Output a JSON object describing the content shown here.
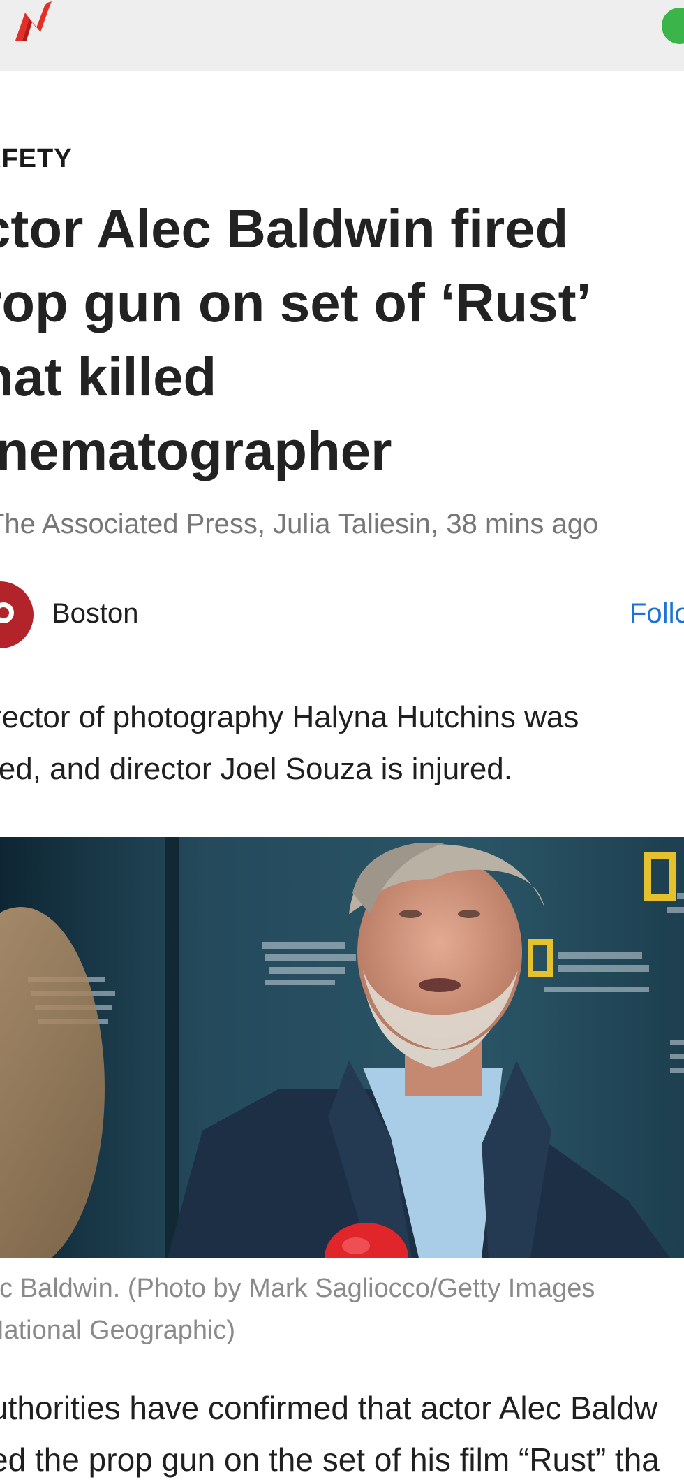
{
  "app": {
    "logo_icon": "msn-logo-icon",
    "profile_icon": "profile-avatar-icon",
    "accent_color": "#e23028",
    "profile_color": "#3bb54a"
  },
  "article": {
    "category": "AFETY",
    "headline_lines": [
      "ctor Alec Baldwin fired",
      "rop gun on set of ‘Rust’",
      "hat killed",
      "inematographer"
    ],
    "byline": "The Associated Press, Julia Taliesin, 38 mins ago",
    "source": {
      "name": "Boston",
      "follow_label": "Follo",
      "logo_color": "#b3232a"
    },
    "summary_lines": [
      "rector of photography Halyna Hutchins was",
      "led, and director Joel Souza is injured."
    ],
    "photo": {
      "alt_subject": "news-photo"
    },
    "caption_lines": [
      "ec Baldwin. (Photo by Mark Sagliocco/Getty Images",
      "National Geographic)"
    ],
    "body_lines": [
      "uthorities have confirmed that actor Alec Baldw",
      "ed the prop gun on the set of his film “Rust” tha"
    ]
  }
}
